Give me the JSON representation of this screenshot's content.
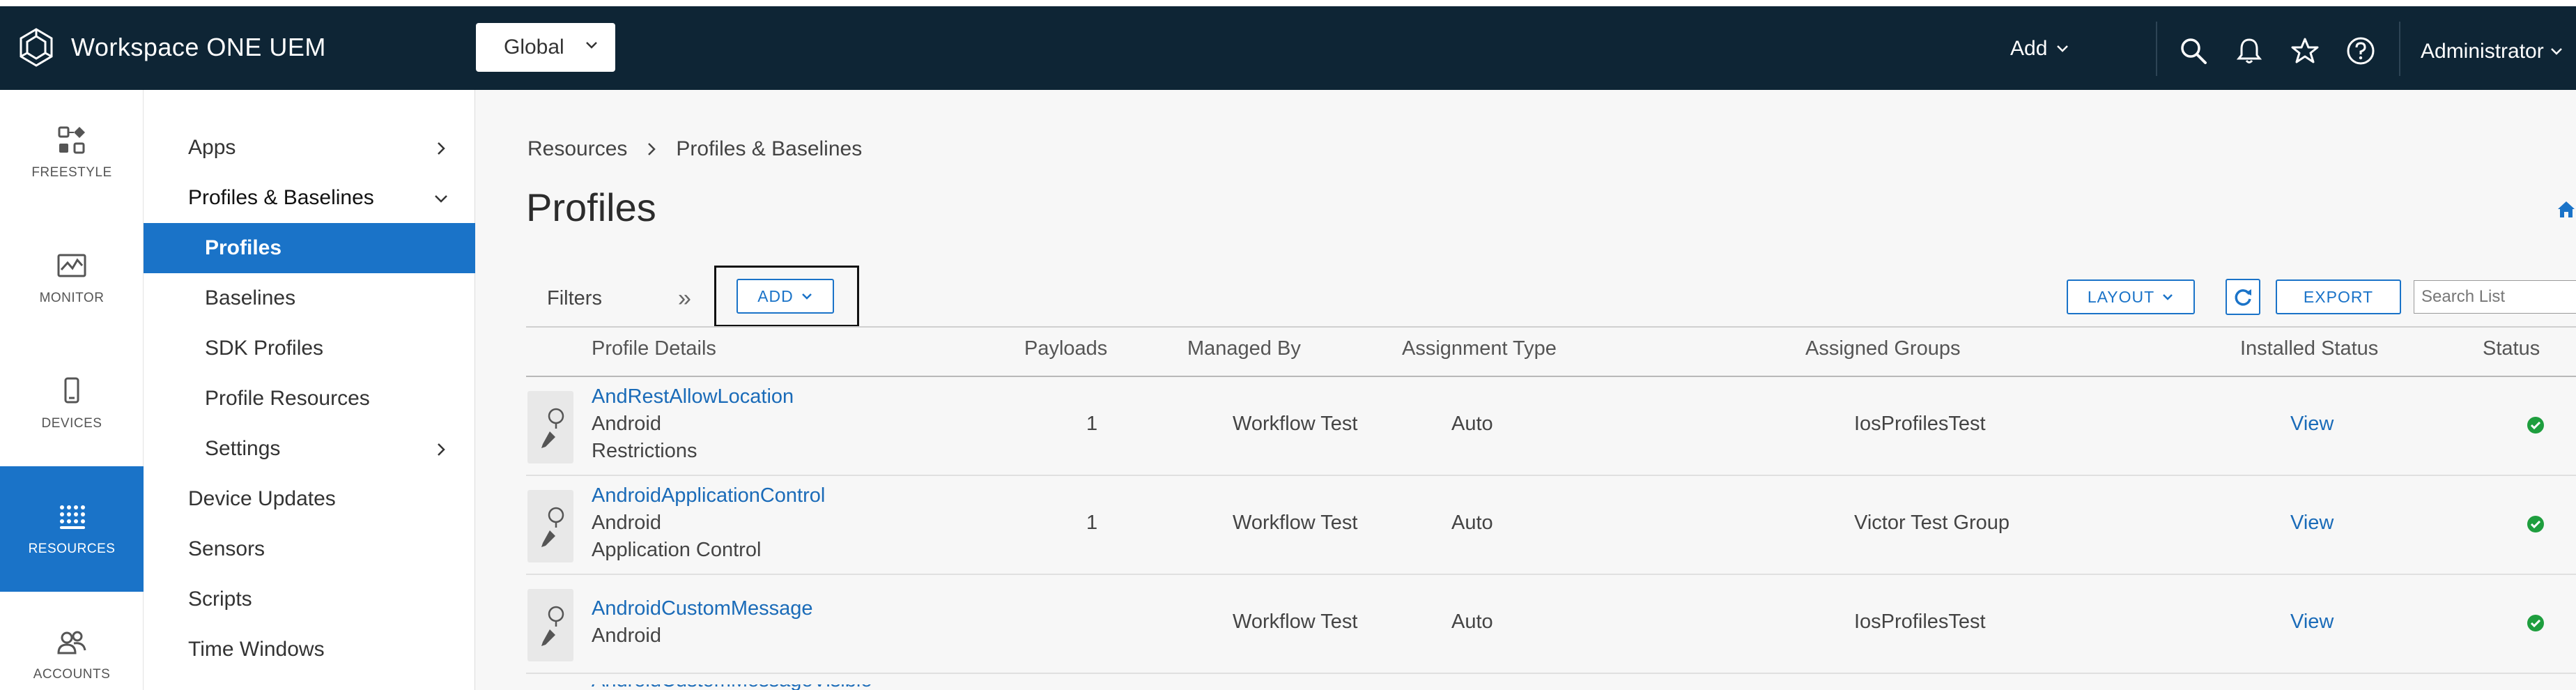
{
  "header": {
    "app_title": "Workspace ONE UEM",
    "org_selector": "Global",
    "add_label": "Add",
    "user_label": "Administrator"
  },
  "rail": {
    "items": [
      {
        "label": "FREESTYLE",
        "icon": "freestyle-icon"
      },
      {
        "label": "MONITOR",
        "icon": "monitor-icon"
      },
      {
        "label": "DEVICES",
        "icon": "devices-icon"
      },
      {
        "label": "RESOURCES",
        "icon": "resources-icon",
        "active": true
      },
      {
        "label": "ACCOUNTS",
        "icon": "accounts-icon"
      }
    ]
  },
  "subnav": {
    "items": [
      {
        "label": "Apps",
        "has_arrow": true
      },
      {
        "label": "Profiles & Baselines",
        "expanded": true
      },
      {
        "label": "Profiles",
        "selected": true
      },
      {
        "label": "Baselines"
      },
      {
        "label": "SDK Profiles"
      },
      {
        "label": "Profile Resources"
      },
      {
        "label": "Settings",
        "has_arrow": true
      },
      {
        "label": "Device Updates"
      },
      {
        "label": "Sensors"
      },
      {
        "label": "Scripts"
      },
      {
        "label": "Time Windows"
      }
    ]
  },
  "main": {
    "breadcrumb": [
      "Resources",
      "Profiles & Baselines"
    ],
    "title": "Profiles",
    "filters_label": "Filters",
    "add_button": "ADD",
    "layout_button": "LAYOUT",
    "export_button": "EXPORT",
    "search_placeholder": "Search List",
    "columns": [
      "Profile Details",
      "Payloads",
      "Managed By",
      "Assignment Type",
      "Assigned Groups",
      "Installed Status",
      "Status"
    ],
    "rows": [
      {
        "name": "AndRestAllowLocation",
        "platform": "Android",
        "payload_type": "Restrictions",
        "payloads": "1",
        "managed_by": "Workflow Test",
        "assignment": "Auto",
        "groups": "IosProfilesTest",
        "installed": "View",
        "status": "active"
      },
      {
        "name": "AndroidApplicationControl",
        "platform": "Android",
        "payload_type": "Application Control",
        "payloads": "1",
        "managed_by": "Workflow Test",
        "assignment": "Auto",
        "groups": "Victor Test Group",
        "installed": "View",
        "status": "active"
      },
      {
        "name": "AndroidCustomMessage",
        "platform": "Android",
        "payload_type": "",
        "payloads": "",
        "managed_by": "Workflow Test",
        "assignment": "Auto",
        "groups": "IosProfilesTest",
        "installed": "View",
        "status": "active"
      }
    ],
    "partial_row_name": "AndroidCustomMessageVisible"
  },
  "colors": {
    "header_bg": "#0e2535",
    "accent": "#1a73c8",
    "link": "#1a6bb8",
    "status_green": "#1e9e3e"
  }
}
